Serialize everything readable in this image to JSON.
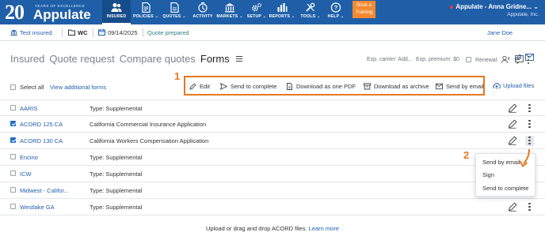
{
  "topbar": {
    "logo_number": "20",
    "logo_tagline": "YEARS OF EXCELLENCE",
    "logo_name": "Appulate",
    "nav": [
      {
        "label": "INSURED",
        "icon": "users-icon"
      },
      {
        "label": "POLICIES",
        "icon": "document-icon"
      },
      {
        "label": "QUOTES",
        "icon": "quote-document-icon"
      },
      {
        "label": "ACTIVITY",
        "icon": "activity-icon"
      },
      {
        "label": "MARKETS",
        "icon": "bank-icon"
      },
      {
        "label": "SETUP",
        "icon": "gears-icon"
      },
      {
        "label": "REPORTS",
        "icon": "bar-chart-icon"
      },
      {
        "label": "TOOLS",
        "icon": "tools-icon"
      },
      {
        "label": "HELP",
        "icon": "help-icon"
      }
    ],
    "book_training": "Book a Training",
    "user_name": "Appulate - Anna Gridne...",
    "user_company": "Appulate, Inc."
  },
  "context": {
    "insured": "Test insured",
    "line": "WC",
    "date": "09/14/2025",
    "status": "Quote prepared",
    "owner": "Jane Doe"
  },
  "breadcrumbs": {
    "items": [
      "Insured",
      "Quote request",
      "Compare quotes"
    ],
    "current": "Forms"
  },
  "summary": {
    "exp_carrier": "Exp. carrier: Add...",
    "exp_premium": "Exp. premium: $0",
    "renewal_label": "Renewal"
  },
  "toolbar": {
    "select_all": "Select all",
    "view_additional": "View additional forms",
    "actions": [
      "Edit",
      "Send to complete",
      "Download as one PDF",
      "Download as archive",
      "Send by email"
    ],
    "upload": "Upload files"
  },
  "annotations": {
    "marker1": "1",
    "marker2": "2"
  },
  "forms": [
    {
      "name": "AARIS",
      "type": "Type: Supplemental",
      "checked": false,
      "edit": true
    },
    {
      "name": "ACORD 125 CA",
      "type": "California Commercial Insurance Application",
      "checked": true,
      "edit": true
    },
    {
      "name": "ACORD 130 CA",
      "type": "California Workers Compensation Application",
      "checked": true,
      "edit": true
    },
    {
      "name": "Encino",
      "type": "Type: Supplemental",
      "checked": false,
      "edit": false
    },
    {
      "name": "ICW",
      "type": "Type: Supplemental",
      "checked": false,
      "edit": false
    },
    {
      "name": "Midwest - Califor...",
      "type": "Type: Supplemental",
      "checked": false,
      "edit": false
    },
    {
      "name": "Westlake GA",
      "type": "Type: Supplemental",
      "checked": false,
      "edit": true
    }
  ],
  "row_menu": {
    "items": [
      "Send by email",
      "Sign",
      "Send to complete"
    ]
  },
  "footer": {
    "text": "Upload or drag and drop ACORD files.",
    "link": "Learn more"
  },
  "colors": {
    "brand": "#1f5fa8",
    "highlight": "#e87722",
    "training": "#f28a30"
  }
}
